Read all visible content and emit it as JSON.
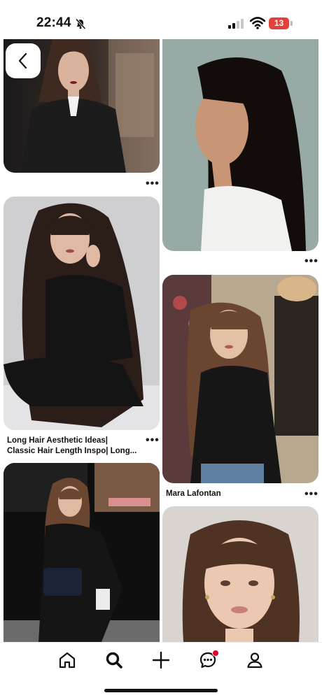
{
  "status_bar": {
    "time": "22:44",
    "battery": "13",
    "icons": [
      "bell-slash-icon",
      "cellular-signal-icon",
      "wifi-icon",
      "battery-icon"
    ]
  },
  "feed": {
    "pins": [
      {
        "id": "pin-1",
        "description": "woman with bangs in black coat",
        "caption": ""
      },
      {
        "id": "pin-2",
        "description": "profile portrait with long black hair",
        "caption": ""
      },
      {
        "id": "pin-3",
        "description": "long wavy brown hair sitting pose",
        "caption_line1": "Long Hair Aesthetic Ideas|",
        "caption_line2": "Classic Hair Length Inspo| Long..."
      },
      {
        "id": "pin-4",
        "description": "woman in black turtleneck",
        "caption": "Mara Lafontan"
      },
      {
        "id": "pin-5",
        "description": "woman by shop window with bag",
        "caption": ""
      },
      {
        "id": "pin-6",
        "description": "close-up portrait with curtain bangs",
        "caption": ""
      }
    ],
    "more_label": "•••"
  },
  "navigation": {
    "items": [
      {
        "name": "home",
        "icon": "home-icon"
      },
      {
        "name": "search",
        "icon": "search-icon",
        "active": true
      },
      {
        "name": "create",
        "icon": "plus-icon"
      },
      {
        "name": "messages",
        "icon": "chat-icon",
        "has_notification": true
      },
      {
        "name": "profile",
        "icon": "profile-icon"
      }
    ]
  },
  "colors": {
    "notification": "#e60023",
    "battery": "#e0413b"
  }
}
